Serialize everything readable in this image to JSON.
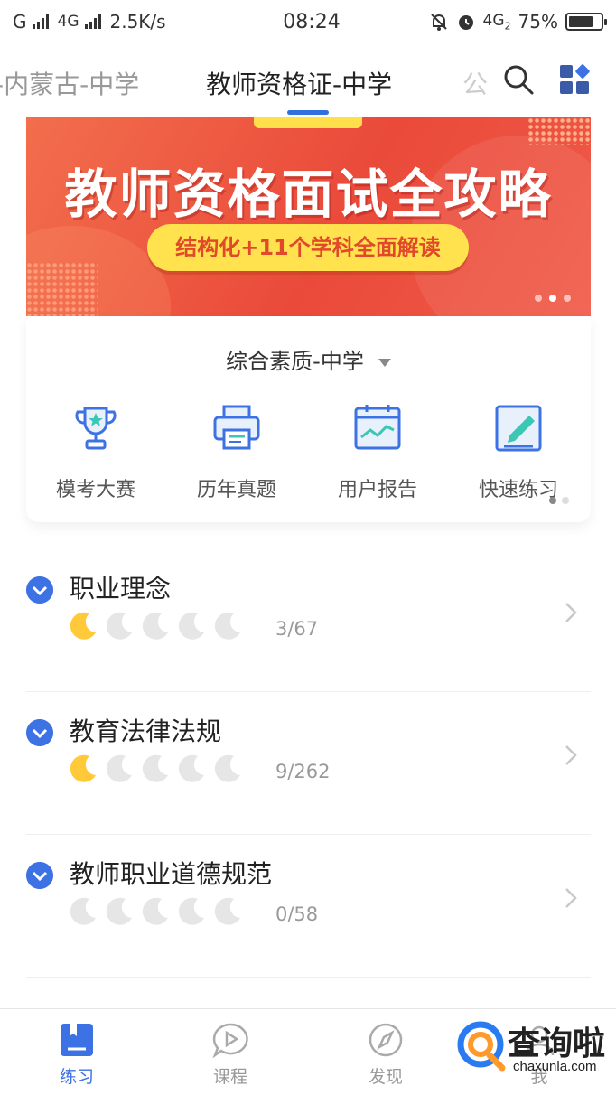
{
  "status_bar": {
    "carrier1": "G",
    "carrier2": "4G",
    "speed": "2.5K/s",
    "time": "08:24",
    "network": "4G",
    "network_sub": "2",
    "battery": "75%",
    "battery_level": 0.75
  },
  "top_nav": {
    "tab_prev": "-内蒙古-中学",
    "tab_active": "教师资格证-中学",
    "tab_next": "公"
  },
  "banner": {
    "title": "教师资格面试全攻略",
    "subtitle": "结构化+11个学科全面解读"
  },
  "card": {
    "subject": "综合素质-中学",
    "tools": [
      {
        "label": "模考大赛",
        "icon": "trophy-icon"
      },
      {
        "label": "历年真题",
        "icon": "printer-icon"
      },
      {
        "label": "用户报告",
        "icon": "chart-icon"
      },
      {
        "label": "快速练习",
        "icon": "edit-icon"
      }
    ]
  },
  "chapters": [
    {
      "title": "职业理念",
      "progress": "3/67",
      "level": 1
    },
    {
      "title": "教育法律法规",
      "progress": "9/262",
      "level": 1
    },
    {
      "title": "教师职业道德规范",
      "progress": "0/58",
      "level": 0
    }
  ],
  "bottom_nav": [
    {
      "label": "练习",
      "active": true
    },
    {
      "label": "课程",
      "active": false
    },
    {
      "label": "发现",
      "active": false
    },
    {
      "label": "我",
      "active": false
    }
  ],
  "watermark": {
    "text": "查询啦",
    "url": "chaxunla.com"
  },
  "colors": {
    "accent": "#3d72e4",
    "banner": "#ea4a3a",
    "moon_on": "#ffc93a",
    "moon_off": "#e6e6e6"
  }
}
